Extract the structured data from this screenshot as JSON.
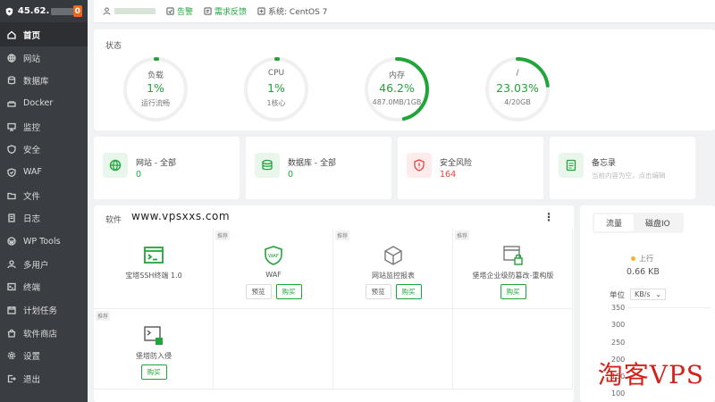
{
  "sidebar": {
    "ip": "45.62.",
    "badge": "0",
    "items": [
      {
        "label": "首页",
        "icon": "home-icon",
        "active": true
      },
      {
        "label": "网站",
        "icon": "globe-icon"
      },
      {
        "label": "数据库",
        "icon": "database-icon"
      },
      {
        "label": "Docker",
        "icon": "docker-icon"
      },
      {
        "label": "监控",
        "icon": "monitor-icon"
      },
      {
        "label": "安全",
        "icon": "shield-icon"
      },
      {
        "label": "WAF",
        "icon": "waf-icon"
      },
      {
        "label": "文件",
        "icon": "folder-icon"
      },
      {
        "label": "日志",
        "icon": "log-icon"
      },
      {
        "label": "WP Tools",
        "icon": "wordpress-icon"
      },
      {
        "label": "多用户",
        "icon": "users-icon"
      },
      {
        "label": "终端",
        "icon": "terminal-icon"
      },
      {
        "label": "计划任务",
        "icon": "calendar-icon"
      },
      {
        "label": "软件商店",
        "icon": "store-icon"
      },
      {
        "label": "设置",
        "icon": "gear-icon"
      },
      {
        "label": "退出",
        "icon": "logout-icon"
      }
    ]
  },
  "topbar": {
    "alarm": "告警",
    "feedback": "需求反馈",
    "system": "系统: CentOS 7"
  },
  "status": {
    "title": "状态",
    "gauges": [
      {
        "label": "负载",
        "value": "1%",
        "sub": "运行流畅",
        "percent": 1
      },
      {
        "label": "CPU",
        "value": "1%",
        "sub": "1核心",
        "percent": 1
      },
      {
        "label": "内存",
        "value": "46.2%",
        "sub": "487.0MB/1GB",
        "percent": 46.2
      },
      {
        "label": "/",
        "value": "23.03%",
        "sub": "4/20GB",
        "percent": 23.03
      }
    ]
  },
  "cards": {
    "site": {
      "title": "网站 - 全部",
      "value": "0"
    },
    "db": {
      "title": "数据库 - 全部",
      "value": "0"
    },
    "risk": {
      "title": "安全风险",
      "value": "164"
    },
    "memo": {
      "title": "备忘录",
      "desc": "当前内容为空，点击编辑"
    }
  },
  "software": {
    "title": "软件",
    "watermark": "www.vpsxxs.com",
    "more": "⋮",
    "items": [
      {
        "name": "宝塔SSH终端 1.0",
        "tag": "",
        "buttons": []
      },
      {
        "name": "WAF",
        "tag": "推荐",
        "buttons": [
          "预览",
          "购买"
        ]
      },
      {
        "name": "网站监控报表",
        "tag": "推荐",
        "buttons": [
          "预览",
          "购买"
        ]
      },
      {
        "name": "堡塔企业级防篡改-重构版",
        "tag": "推荐",
        "buttons": [
          "购买"
        ]
      },
      {
        "name": "堡塔防入侵",
        "tag": "推荐",
        "buttons": [
          "购买"
        ]
      }
    ]
  },
  "traffic": {
    "tabs": [
      "流量",
      "磁盘IO"
    ],
    "legend": "上行",
    "up_value": "0.66 KB",
    "unit_label": "单位",
    "unit_value": "KB/s",
    "unit_arrow": "⌄",
    "y_ticks": [
      "350",
      "300",
      "250",
      "200",
      "150",
      "100"
    ]
  },
  "watermark": "淘客VPS",
  "colors": {
    "accent": "#20a53a",
    "danger": "#ef4040",
    "sidebar": "#3a3d41",
    "badge": "#f0641e"
  }
}
